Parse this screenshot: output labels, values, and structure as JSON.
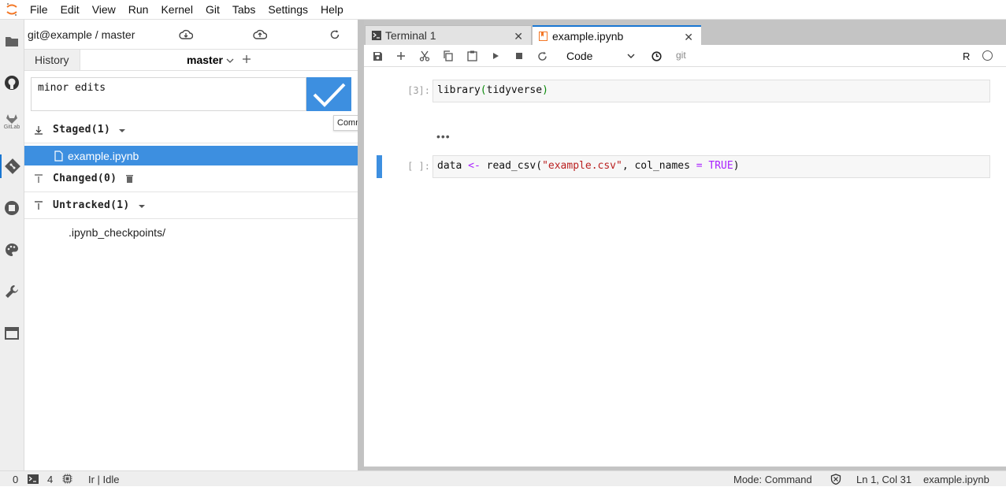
{
  "menu": [
    "File",
    "Edit",
    "View",
    "Run",
    "Kernel",
    "Git",
    "Tabs",
    "Settings",
    "Help"
  ],
  "activity_bar": {
    "items": [
      "folder-icon",
      "github-icon",
      "gitlab-icon",
      "git-icon",
      "running-icon",
      "palette-icon",
      "wrench-icon",
      "tabs-icon"
    ],
    "gitlab_label": "GitLab"
  },
  "git_panel": {
    "repo_label": "git@example / master",
    "history_tab": "History",
    "branch": "master",
    "commit_message": "minor edits",
    "commit_tooltip": "Commit",
    "staged_label": "Staged(1)",
    "staged_files": [
      "example.ipynb"
    ],
    "changed_label": "Changed(0)",
    "untracked_label": "Untracked(1)",
    "untracked_files": [
      ".ipynb_checkpoints/"
    ]
  },
  "tabs": [
    {
      "label": "Terminal 1",
      "active": false
    },
    {
      "label": "example.ipynb",
      "active": true
    }
  ],
  "notebook": {
    "cell_type": "Code",
    "git_label": "git",
    "kernel": "R",
    "cells": [
      {
        "prompt": "[3]:",
        "code_parts": [
          "library",
          "(",
          "tidyverse",
          ")"
        ]
      },
      {
        "prompt": "[ ]:",
        "code_parts": [
          "data ",
          "<-",
          " read_csv(",
          "\"example.csv\"",
          ", col_names ",
          "=",
          " ",
          "TRUE",
          ")"
        ]
      }
    ],
    "output_ellipsis": "•••"
  },
  "status_bar": {
    "count_a": "0",
    "count_b": "4",
    "kernel_status": "Ir | Idle",
    "mode": "Mode: Command",
    "cursor": "Ln 1, Col 31",
    "file": "example.ipynb"
  },
  "colors": {
    "accent": "#3d8fe0",
    "brand": "#1976d2",
    "jupyter_orange": "#f37726"
  }
}
